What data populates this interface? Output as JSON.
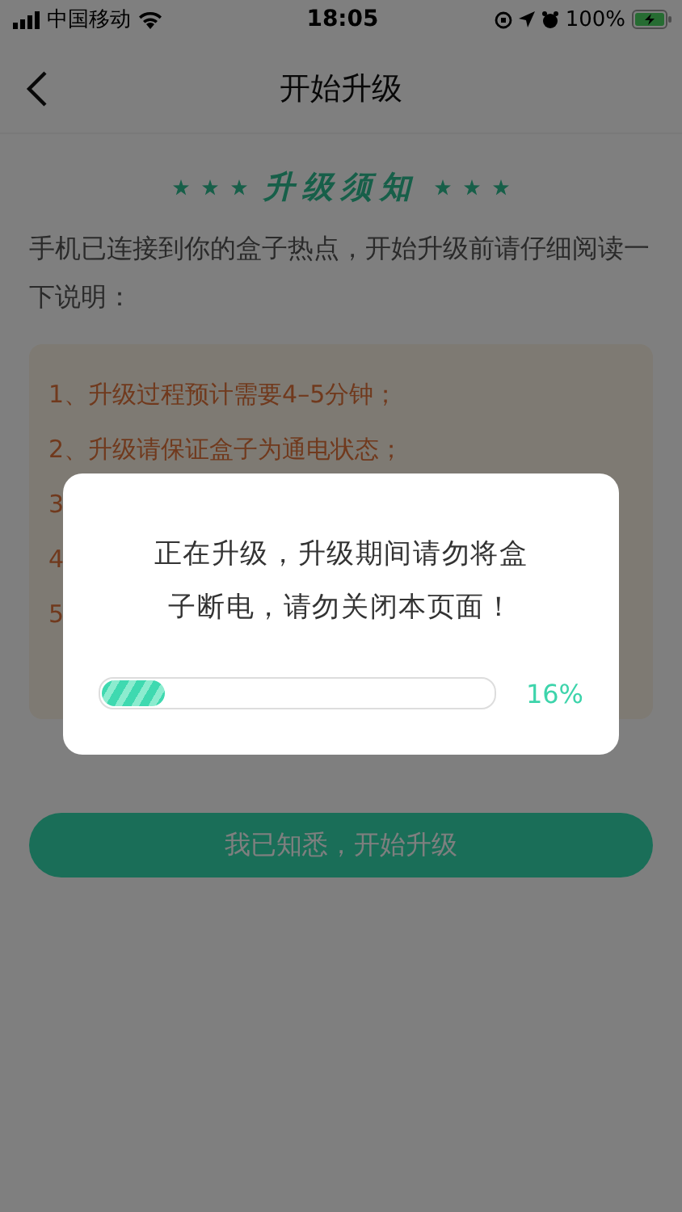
{
  "status_bar": {
    "carrier": "中国移动",
    "time": "18:05",
    "battery": "100%"
  },
  "nav": {
    "title": "开始升级"
  },
  "notice": {
    "heading": "升级须知",
    "intro": "手机已连接到你的盒子热点，开始升级前请仔细阅读一下说明：",
    "items": [
      "1、升级过程预计需要4–5分钟；",
      "2、升级请保证盒子为通电状态；",
      "3",
      "4",
      "5"
    ]
  },
  "button": {
    "label": "我已知悉，开始升级"
  },
  "dialog": {
    "message": "正在升级，升级期间请勿将盒子断电，请勿关闭本页面！",
    "progress": {
      "level": 0.16,
      "reading": "16%"
    }
  }
}
